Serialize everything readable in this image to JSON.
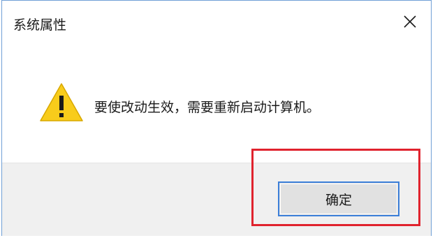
{
  "window": {
    "title": "系统属性",
    "close_icon": "close-icon"
  },
  "message": {
    "icon": "warning-icon",
    "text": "要使改动生效，需要重新启动计算机。"
  },
  "footer": {
    "ok_label": "确定"
  },
  "colors": {
    "warning_fill": "#f8cc1b",
    "button_focus_border": "#3c7fd9",
    "highlight": "#e0232e",
    "footer_bg": "#f0f0f0"
  }
}
